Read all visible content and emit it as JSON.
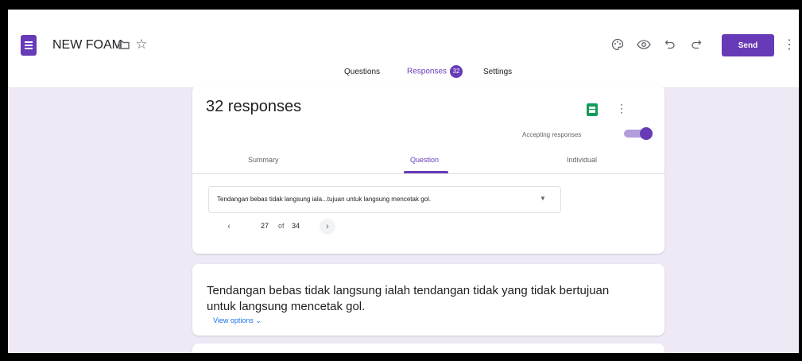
{
  "app": {
    "form_title": "NEW FOAM",
    "send_label": "Send",
    "accent_color": "#673ab7"
  },
  "tabs": {
    "questions": "Questions",
    "responses": "Responses",
    "responses_badge": "32",
    "settings": "Settings"
  },
  "summary_card": {
    "heading": "32 responses",
    "accepting_label": "Accepting responses",
    "accepting_on": true,
    "subtabs": {
      "summary": "Summary",
      "question": "Question",
      "individual": "Individual"
    },
    "question_select": "Tendangan bebas tidak langsung iala...tujuan untuk langsung mencetak gol.",
    "pager": {
      "current": "27",
      "of": "of",
      "total": "34"
    }
  },
  "question_card": {
    "title": "Tendangan bebas tidak langsung ialah tendangan tidak yang tidak bertujuan untuk langsung mencetak gol.",
    "view_options": "View options"
  },
  "icons": {
    "form": "form-icon",
    "folder": "folder-icon",
    "star": "star-icon",
    "palette": "palette-icon",
    "preview": "eye-icon",
    "undo": "undo-icon",
    "redo": "redo-icon",
    "more": "more-vert-icon",
    "sheets": "sheets-icon",
    "dropdown": "dropdown-arrow-icon",
    "prev": "chevron-left-icon",
    "next": "chevron-right-icon"
  }
}
